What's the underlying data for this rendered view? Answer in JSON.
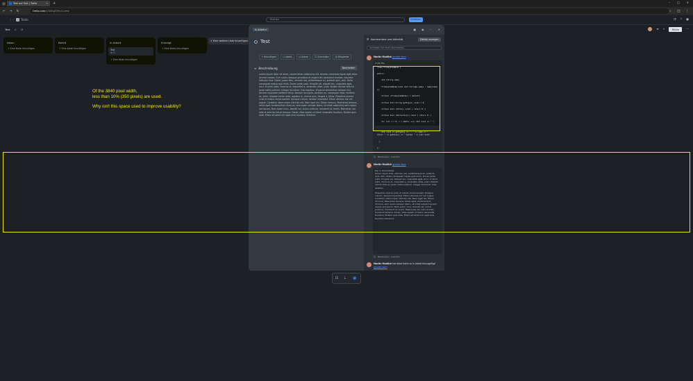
{
  "browser": {
    "tab_title": "Test auf Test | Trello",
    "new_tab": "+",
    "url_host": "trello.com",
    "url_path": "/c/4StqZ5Hn/1-test",
    "back": "←",
    "forward": "→",
    "reload": "↻",
    "window_min": "–",
    "window_max": "□",
    "window_close": "✕"
  },
  "app": {
    "logo": "Trello",
    "search_placeholder": "Suchen",
    "create": "Erstellen"
  },
  "board": {
    "name": "Test",
    "share": "Teilen",
    "lists": [
      {
        "title": "Ideen",
        "cards": [],
        "add": "+ Eine Karte hinzufügen"
      },
      {
        "title": "Bereit",
        "cards": [],
        "add": "+ Eine Karte hinzufügen"
      },
      {
        "title": "In Arbeit",
        "cards": [
          "Test",
          "≡  ☐"
        ],
        "add": "+ Eine Karte hinzufügen"
      },
      {
        "title": "Erledigt",
        "cards": [],
        "add": "+ Eine Karte hinzufügen"
      }
    ],
    "add_list": "+ Eine weitere Liste hinzufügen"
  },
  "modal": {
    "list_chip": "In Arbeit ▾",
    "title": "Test",
    "actions": [
      "+ Hinzufügen",
      "◇ Labels",
      "◷ Datum",
      "☑ Checkliste",
      "☺ Mitglieder"
    ],
    "description_heading": "Beschreibung",
    "edit": "Bearbeiten",
    "description": "Lorem ipsum dolor sit amet, consectetuer adipiscing elit. Aenean commodo ligula eget dolor. Aenean massa. Cum sociis natoque penatibus et magnis dis parturient montes, nascetur ridiculus mus. Donec quam felis, ultricies nec, pellentesque eu, pretium quis, sem. Nulla consequat massa quis enim. Donec pede justo, fringilla vel, aliquet nec, vulputate eget, arcu. In enim justo, rhoncus ut, imperdiet a, venenatis vitae, justo. Nullam dictum felis eu pede mollis pretium. Integer tincidunt. Cras dapibus. Vivamus elementum semper nisi. Aenean vulputate eleifend tellus. Aenean leo ligula, porttitor eu, consequat vitae, eleifend ac, enim. Aliquam lorem ante, dapibus in, viverra quis, feugiat a, tellus. Phasellus viverra nulla ut metus varius laoreet. Quisque rutrum. Aenean imperdiet. Etiam ultricies nisi vel augue. Curabitur ullamcorper ultricies nisi. Nam eget dui. Etiam rhoncus. Maecenas tempus, tellus eget condimentum rhoncus, sem quam semper libero, sit amet adipiscing sem neque sed ipsum. Nam quam nunc, blandit vel, luctus pulvinar, hendrerit id, lorem. Maecenas nec odio et ante tincidunt tempus. Donec vitae sapien ut libero venenatis faucibus. Nullam quis ante. Etiam sit amet orci eget eros faucibus tincidunt.",
    "activity_heading": "Kommentare und Aktivität",
    "details_button": "Details anzeigen",
    "comment_placeholder": "Schreiben Sie einen Kommentar…",
    "comments": [
      {
        "author": "Martin Modlich",
        "time": "gerade eben",
        "label": "Code File",
        "code": "class FileSystemNode {\n\npublic:\n\n    std::string name;\n\n    FileSystemNode(const std::string& name) : name(name)\n{}\n\n    virtual ~FileSystemNode() = default;\n\n    virtual std::string getType() const = 0;\n\n    virtual bool isFile() const { return 0; }\n\n    virtual bool isDirectory() const { return 0; }\n\n    for (int i = 0; i < depth; ++i) std::cout << \" \";",
        "code_tail": "    std::cout << getType() << \": \" << name << \"\n[Size: \" << getSize() << \" bytes] \" << std::endl;\n\n  }\n\n};",
        "reply": "☺ ·  Bearbeiten  ·  Löschen"
      },
      {
        "author": "Martin Modlich",
        "time": "gerade eben",
        "p1": "Der 1. Kommentar",
        "p2": "Donec quam felis, ultricies nec, pellentesque eu, pretium quis, sem. Nulla consequat massa quis enim. Donec pede justo, fringilla vel, aliquet nec, vulputate eget, arcu. In enim justo, rhoncus ut, imperdiet a, venenatis vitae, justo. Nullam dictum felis eu pede mollis pretium. Integer tincidunt. Cras dapibus.",
        "p3": "Phasellus viverra nulla ut metus varius laoreet. Quisque rutrum. Aenean imperdiet. Etiam ultricies nisi vel augue. Curabitur ullamcorper ultricies nisi. Nam eget dui. Etiam rhoncus. Maecenas tempus, tellus eget condimentum rhoncus, sem quam semper libero, sit amet adipiscing sem neque sed ipsum. Nam quam nunc, blandit vel, luctus pulvinar, hendrerit id, lorem. Maecenas nec odio et ante tincidunt tempus. Donec vitae sapien ut libero venenatis faucibus. Nullam quis ante. Etiam sit amet orci eget eros faucibus tincidunt.",
        "reply": "☺ ·  Bearbeiten  ·  Löschen"
      }
    ],
    "activity": {
      "author": "Martin Modlich",
      "text": "hat diese Karte zu In Arbeit hinzugefügt",
      "time": "gerade eben"
    }
  },
  "annotation": {
    "line1": "Of the 3840 pixel width,",
    "line2": "less than 10% (350 pixels) are used.",
    "line3": "Why isn't this space used to improve usability?",
    "color": "#f3e600"
  },
  "floatbar": {
    "a": "⊡",
    "b": "⇣",
    "c": "▦"
  }
}
